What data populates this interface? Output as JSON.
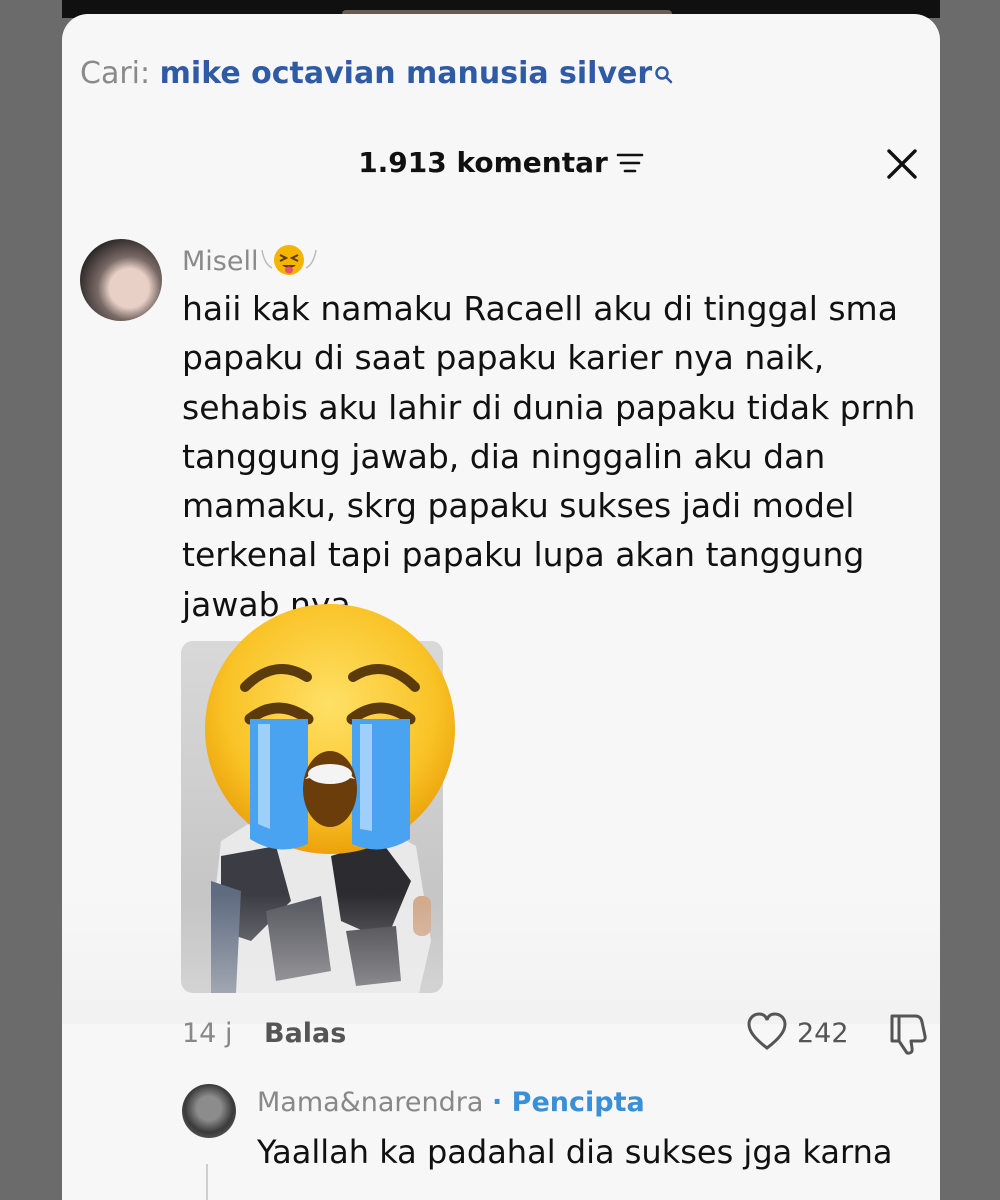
{
  "search": {
    "label": "Cari:",
    "query": "mike octavian manusia silver"
  },
  "header": {
    "count_text": "1.913 komentar"
  },
  "comment": {
    "username": "Misell",
    "text": "haii kak namaku Racaell aku di tinggal sma papaku di saat papaku karier nya naik, sehabis aku lahir di dunia papaku tidak prnh tanggung jawab, dia ninggalin aku dan mamaku, skrg papaku sukses jadi model terkenal tapi papaku lupa akan tanggung jawab nya",
    "time": "14 j",
    "reply_label": "Balas",
    "likes": "242"
  },
  "reply": {
    "username": "Mama&narendra",
    "badge": "· Pencipta",
    "text": "Yaallah ka padahal dia sukses jga karna"
  },
  "icons": [
    "search-icon",
    "filter-icon",
    "close-icon",
    "emoji-icon",
    "crying-emoji-icon",
    "heart-icon",
    "dislike-icon"
  ],
  "colors": {
    "accent": "#2f5aa6",
    "creator": "#3a8fd6",
    "background": "#6b6b6b"
  }
}
